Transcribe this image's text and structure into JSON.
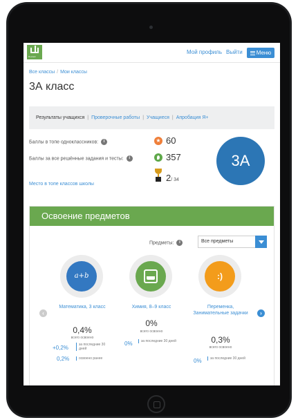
{
  "header": {
    "logo_text": "Я-класс",
    "profile_link": "Мой профиль",
    "logout_link": "Выйти",
    "menu_label": "Меню"
  },
  "breadcrumb": {
    "all_classes": "Все классы",
    "separator": "/",
    "my_classes": "Мои классы"
  },
  "page_title": "3А класс",
  "tabs": [
    {
      "label": "Результаты учащихся",
      "active": true
    },
    {
      "label": "Проверочные работы",
      "active": false
    },
    {
      "label": "Учащиеся",
      "active": false
    },
    {
      "label": "Апробация Я+",
      "active": false
    }
  ],
  "tab_separator": "|",
  "stats": {
    "classmates_score_label": "Баллы в топе одноклассников:",
    "classmates_score": "60",
    "solved_score_label": "Баллы за все решённые задания и тесты:",
    "solved_score": "357",
    "school_rank_label": "Место в топе классов школы",
    "school_rank": "2",
    "school_rank_total": "/ 34",
    "class_badge": "3А"
  },
  "mastery": {
    "title": "Освоение предметов",
    "subjects_label": "Предметы:",
    "subjects_select": "Все предметы",
    "subjects": [
      {
        "name": "Математика, 3 класс",
        "icon_text": "a+b",
        "percent": "0,4%",
        "percent_caption": "всего освоено",
        "recent_delta": "+0,2%",
        "recent_note": "за последние 30 дней",
        "earlier_delta": "0,2%",
        "earlier_note": "освоено ранее"
      },
      {
        "name": "Химия, 8–9 класс",
        "icon_text": "",
        "percent": "0%",
        "percent_caption": "всего освоено",
        "recent_delta": "0%",
        "recent_note": "за последние 30 дней"
      },
      {
        "name": "Переменка, Занимательные задачки",
        "icon_text": ":)",
        "percent": "0,3%",
        "percent_caption": "всего освоено",
        "recent_delta": "0%",
        "recent_note": "за последние 30 дней"
      }
    ],
    "prev_arrow": "‹",
    "next_arrow": "›"
  },
  "colors": {
    "accent_blue": "#3b8ed4",
    "green": "#6aa84f",
    "class_badge": "#2c76b5",
    "orange": "#f39c1b"
  }
}
